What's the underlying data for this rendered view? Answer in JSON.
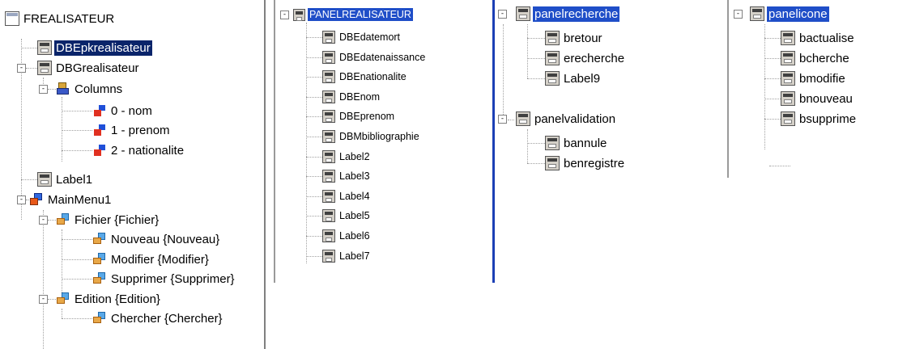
{
  "panel1": {
    "items": [
      {
        "label": "FREALISATEUR",
        "icon": "form-icon"
      },
      {
        "label": "DBEpkrealisateur",
        "icon": "edit-control-icon",
        "selected": true
      },
      {
        "label": "DBGrealisateur",
        "icon": "grid-control-icon",
        "expander": "-"
      },
      {
        "label": "Columns",
        "icon": "columns-collection-icon",
        "expander": "-"
      },
      {
        "label": "0 - nom",
        "icon": "column-icon"
      },
      {
        "label": "1 - prenom",
        "icon": "column-icon"
      },
      {
        "label": "2 - nationalite",
        "icon": "column-icon"
      },
      {
        "label": "Label1",
        "icon": "label-control-icon"
      },
      {
        "label": "MainMenu1",
        "icon": "main-menu-icon",
        "expander": "-"
      },
      {
        "label": "Fichier {Fichier}",
        "icon": "menu-item-icon",
        "expander": "-"
      },
      {
        "label": "Nouveau {Nouveau}",
        "icon": "menu-item-icon"
      },
      {
        "label": "Modifier {Modifier}",
        "icon": "menu-item-icon"
      },
      {
        "label": "Supprimer {Supprimer}",
        "icon": "menu-item-icon"
      },
      {
        "label": "Edition {Edition}",
        "icon": "menu-item-icon",
        "expander": "-"
      },
      {
        "label": "Chercher {Chercher}",
        "icon": "menu-item-icon"
      }
    ]
  },
  "panel2": {
    "root": {
      "label": "PANELREALISATEUR",
      "icon": "panel-icon",
      "expander": "-",
      "selected": true
    },
    "children": [
      "DBEdatemort",
      "DBEdatenaissance",
      "DBEnationalite",
      "DBEnom",
      "DBEprenom",
      "DBMbibliographie",
      "Label2",
      "Label3",
      "Label4",
      "Label5",
      "Label6",
      "Label7"
    ]
  },
  "panel3": {
    "groups": [
      {
        "label": "panelrecherche",
        "expander": "-",
        "selected": true,
        "children": [
          "bretour",
          "erecherche",
          "Label9"
        ]
      },
      {
        "label": "panelvalidation",
        "expander": "-",
        "selected": false,
        "children": [
          "bannule",
          "benregistre"
        ]
      }
    ]
  },
  "panel4": {
    "root": {
      "label": "panelicone",
      "expander": "-",
      "selected": true
    },
    "children": [
      "bactualise",
      "bcherche",
      "bmodifie",
      "bnouveau",
      "bsupprime"
    ]
  },
  "colors": {
    "selection_dark": "#0a246a",
    "selection_blue": "#1f4ec8",
    "tree_line": "#a0a0a0",
    "divider_blue": "#1c3fb5"
  }
}
